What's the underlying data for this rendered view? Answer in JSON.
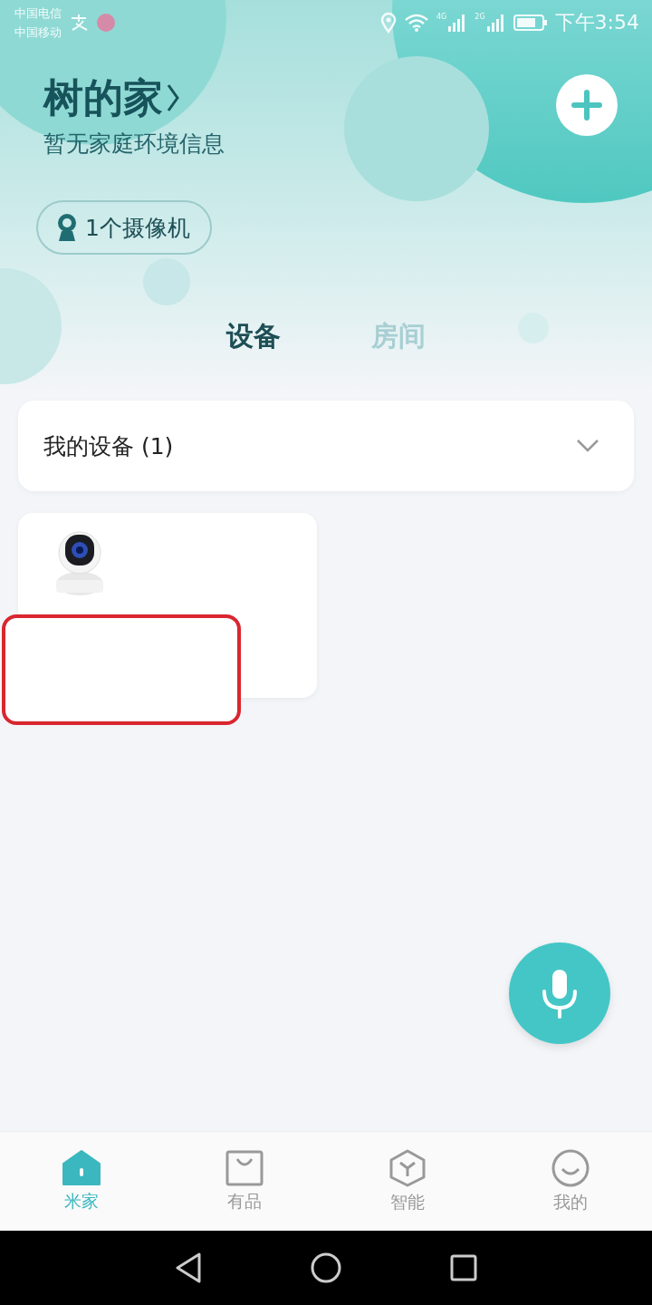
{
  "status_bar": {
    "carriers": [
      "中国电信",
      "中国移动"
    ],
    "network_labels": [
      "4G",
      "2G"
    ],
    "time": "下午3:54"
  },
  "home": {
    "title": "树的家",
    "subtitle": "暂无家庭环境信息",
    "chip": "1个摄像机"
  },
  "tabs": [
    {
      "label": "设备",
      "selected": true
    },
    {
      "label": "房间",
      "selected": false
    }
  ],
  "device_group": {
    "label": "我的设备 (1)"
  },
  "bottom_nav": [
    {
      "label": "米家",
      "kind": "home",
      "selected": true
    },
    {
      "label": "有品",
      "kind": "bag",
      "selected": false
    },
    {
      "label": "智能",
      "kind": "hexagon",
      "selected": false
    },
    {
      "label": "我的",
      "kind": "smile",
      "selected": false
    }
  ]
}
